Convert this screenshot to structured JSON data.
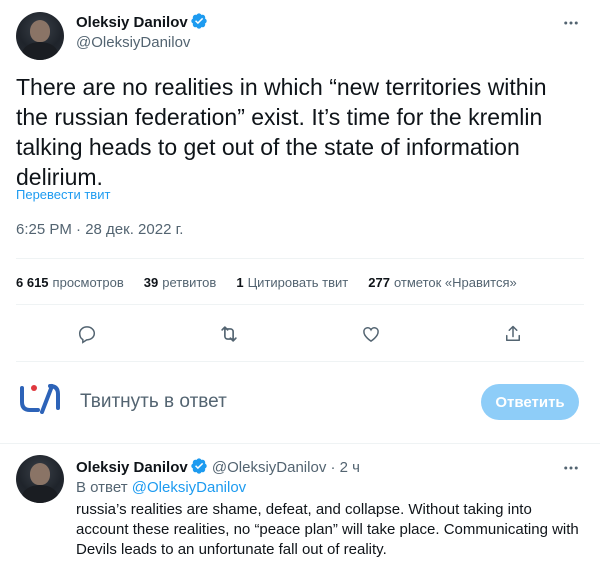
{
  "tweet": {
    "author_name": "Oleksiy Danilov",
    "author_handle": "@OleksiyDanilov",
    "text": "There are no realities in which “new territories within the russian federation” exist. It’s time for the kremlin talking heads to get out of the state of information delirium.",
    "translate_label": "Перевести твит",
    "timestamp": "6:25 PM · 28 дек. 2022 г."
  },
  "stats": {
    "views_count": "6 615",
    "views_label": "просмотров",
    "retweets_count": "39",
    "retweets_label": "ретвитов",
    "quotes_count": "1",
    "quotes_label": "Цитировать твит",
    "likes_count": "277",
    "likes_label": "отметок «Нравится»"
  },
  "reply_box": {
    "placeholder": "Твитнуть в ответ",
    "button_label": "Ответить"
  },
  "reply": {
    "author_name": "Oleksiy Danilov",
    "author_handle": "@OleksiyDanilov",
    "separator": "·",
    "time_ago": "2 ч",
    "reply_to_prefix": "В ответ",
    "reply_to_handle": "@OleksiyDanilov",
    "text": "russia’s realities are shame, defeat, and collapse. Without taking into account these realities, no “peace plan” will take place. Communicating with Devils leads to an unfortunate fall out of reality."
  },
  "colors": {
    "accent": "#1d9bf0",
    "reply_button_disabled": "#8ecdf8",
    "secondary_text": "#536471"
  },
  "icons": [
    "verified-badge-icon",
    "more-icon",
    "reply-icon",
    "retweet-icon",
    "like-icon",
    "share-icon",
    "app-logo-icon"
  ]
}
